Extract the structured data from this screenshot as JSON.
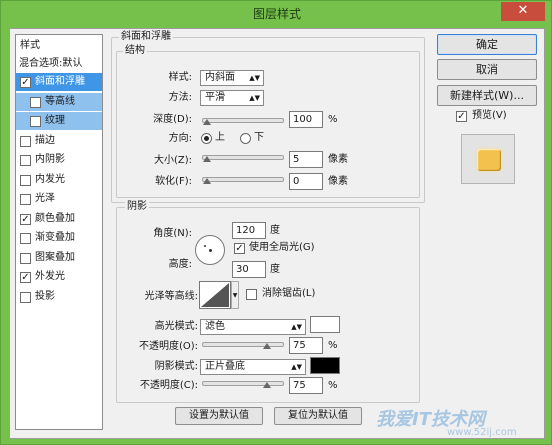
{
  "window": {
    "title": "图层样式",
    "close_glyph": "✕"
  },
  "list": {
    "header": "样式",
    "blend_options": "混合选项:默认",
    "items": [
      {
        "label": "斜面和浮雕",
        "checked": true,
        "selected": true
      },
      {
        "label": "等高线",
        "checked": false,
        "sub": true
      },
      {
        "label": "纹理",
        "checked": false,
        "sub": true
      },
      {
        "label": "描边",
        "checked": false
      },
      {
        "label": "内阴影",
        "checked": false
      },
      {
        "label": "内发光",
        "checked": false
      },
      {
        "label": "光泽",
        "checked": false
      },
      {
        "label": "颜色叠加",
        "checked": true
      },
      {
        "label": "渐变叠加",
        "checked": false
      },
      {
        "label": "图案叠加",
        "checked": false
      },
      {
        "label": "外发光",
        "checked": true
      },
      {
        "label": "投影",
        "checked": false
      }
    ]
  },
  "bevel": {
    "title": "斜面和浮雕",
    "structure_title": "结构",
    "style_label": "样式:",
    "style_value": "内斜面",
    "method_label": "方法:",
    "method_value": "平滑",
    "depth_label": "深度(D):",
    "depth_value": "100",
    "depth_unit": "%",
    "direction_label": "方向:",
    "dir_up": "上",
    "dir_down": "下",
    "size_label": "大小(Z):",
    "size_value": "5",
    "size_unit": "像素",
    "soften_label": "软化(F):",
    "soften_value": "0",
    "soften_unit": "像素"
  },
  "shading": {
    "title": "阴影",
    "angle_label": "角度(N):",
    "angle_value": "120",
    "angle_unit": "度",
    "global_light_label": "使用全局光(G)",
    "altitude_label": "高度:",
    "altitude_value": "30",
    "altitude_unit": "度",
    "gloss_label": "光泽等高线:",
    "antialias_label": "消除锯齿(L)",
    "highlight_mode_label": "高光模式:",
    "highlight_mode_value": "滤色",
    "highlight_opacity_label": "不透明度(O):",
    "highlight_opacity_value": "75",
    "highlight_color": "#ffffff",
    "shadow_mode_label": "阴影模式:",
    "shadow_mode_value": "正片叠底",
    "shadow_opacity_label": "不透明度(C):",
    "shadow_opacity_value": "75",
    "shadow_color": "#000000",
    "percent": "%"
  },
  "buttons": {
    "make_default": "设置为默认值",
    "reset_default": "复位为默认值",
    "ok": "确定",
    "cancel": "取消",
    "new_style": "新建样式(W)...",
    "preview": "预览(V)"
  },
  "preview_color": "#f2c14e",
  "watermark": {
    "main": "我爱IT技术网",
    "url": "www.52ij.com"
  }
}
